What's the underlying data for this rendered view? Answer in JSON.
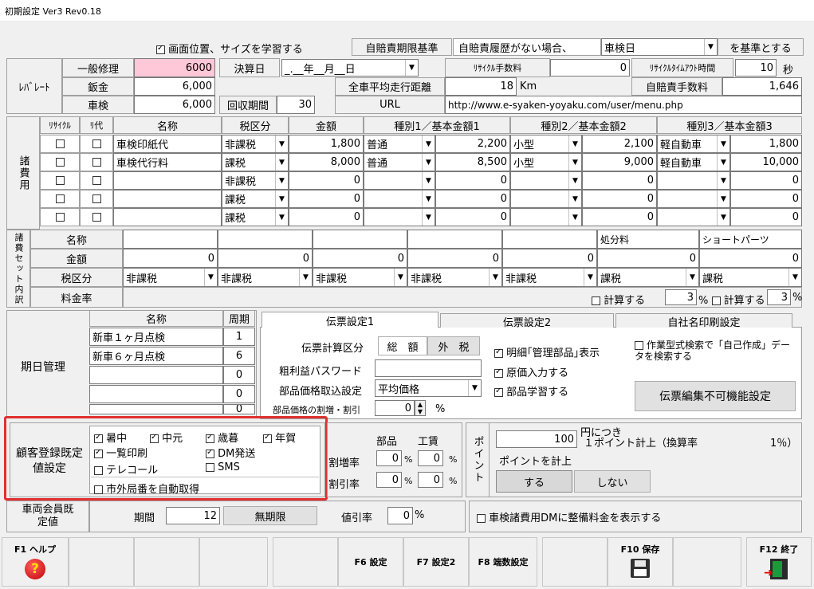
{
  "window": {
    "title": "初期設定 Ver3 Rev0.18"
  },
  "top": {
    "learn_label": "画面位置、サイズを学習する",
    "jibai_basis_label": "自賠責期限基準",
    "no_history_label": "自賠責履歴がない場合、",
    "basis_value": "車検日",
    "basis_suffix": "を基準とする"
  },
  "labor": {
    "section_label": "ﾚﾊﾞﾚｰﾄ",
    "rows": [
      {
        "label": "一般修理",
        "value": "6000"
      },
      {
        "label": "鈑金",
        "value": "6,000"
      },
      {
        "label": "車検",
        "value": "6,000"
      }
    ],
    "settle_label": "決算日",
    "settle_value": "_.__年__月__日",
    "collect_label": "回収期間",
    "collect_value": "30",
    "recycle_fee_label": "ﾘｻｲｸﾙ手数料",
    "recycle_fee_value": "0",
    "recycle_timeout_label": "ﾘｻｲｸﾙﾀｲﾑｱｳﾄ時間",
    "recycle_timeout_value": "10",
    "recycle_timeout_unit": "秒",
    "avg_distance_label": "全車平均走行距離",
    "avg_distance_value": "18",
    "avg_distance_unit": "Km",
    "jibai_fee_label": "自賠責手数料",
    "jibai_fee_value": "1,646",
    "url_label": "URL",
    "url_value": "http://www.e-syaken-yoyaku.com/user/menu.php"
  },
  "fees": {
    "section_label": "諸費用",
    "headers": [
      "ﾘｻｲｸﾙ",
      "ﾘ代",
      "名称",
      "税区分",
      "金額",
      "種別1／基本金額1",
      "種別2／基本金額2",
      "種別3／基本金額3"
    ],
    "rows": [
      {
        "name": "車検印紙代",
        "tax": "非課税",
        "amount": "1,800",
        "t1": "普通",
        "a1": "2,200",
        "t2": "小型",
        "a2": "2,100",
        "t3": "軽自動車",
        "a3": "1,800"
      },
      {
        "name": "車検代行料",
        "tax": "課税",
        "amount": "8,000",
        "t1": "普通",
        "a1": "8,500",
        "t2": "小型",
        "a2": "9,000",
        "t3": "軽自動車",
        "a3": "10,000"
      },
      {
        "name": "",
        "tax": "非課税",
        "amount": "0",
        "t1": "",
        "a1": "0",
        "t2": "",
        "a2": "0",
        "t3": "",
        "a3": "0"
      },
      {
        "name": "",
        "tax": "課税",
        "amount": "0",
        "t1": "",
        "a1": "0",
        "t2": "",
        "a2": "0",
        "t3": "",
        "a3": "0"
      },
      {
        "name": "",
        "tax": "課税",
        "amount": "0",
        "t1": "",
        "a1": "0",
        "t2": "",
        "a2": "0",
        "t3": "",
        "a3": "0"
      }
    ]
  },
  "set": {
    "section_label": "諸費セット内訳",
    "name_label": "名称",
    "amount_label": "金額",
    "tax_label": "税区分",
    "rate_label": "料金率",
    "names": [
      "",
      "",
      "",
      "",
      "",
      "処分料",
      "ショートパーツ"
    ],
    "amounts": [
      "0",
      "0",
      "0",
      "0",
      "0",
      "0",
      "0"
    ],
    "taxes": [
      "非課税",
      "非課税",
      "非課税",
      "非課税",
      "非課税",
      "課税",
      "課税"
    ],
    "calc_label": "計算する",
    "calc1_value": "3",
    "calc2_value": "3",
    "pct": "%"
  },
  "period": {
    "section_label": "期日管理",
    "name_header": "名称",
    "cycle_header": "周期",
    "rows": [
      {
        "name": "新車１ヶ月点検",
        "cycle": "1"
      },
      {
        "name": "新車６ヶ月点検",
        "cycle": "6"
      },
      {
        "name": "",
        "cycle": "0"
      },
      {
        "name": "",
        "cycle": "0"
      },
      {
        "name": "",
        "cycle": "0"
      }
    ]
  },
  "tabs": {
    "items": [
      "伝票設定1",
      "伝票設定2",
      "自社名印刷設定"
    ]
  },
  "slip": {
    "calc_label": "伝票計算区分",
    "total_label": "総　額",
    "outside_label": "外　税",
    "password_label": "粗利益パスワード",
    "parts_price_label": "部品価格取込設定",
    "parts_price_value": "平均価格",
    "discount_label": "部品価格の割増・割引",
    "discount_value": "0",
    "discount_unit": "%",
    "detail_label": "明細｢管理部品｣表示",
    "cost_label": "原価入力する",
    "learn_parts_label": "部品学習する",
    "work_search_label": "作業型式検索で「自己作成」データを検索する",
    "uneditable_label": "伝票編集不可機能設定"
  },
  "customer": {
    "section_label": "顧客登録既定値設定",
    "summer": "暑中",
    "midyear": "中元",
    "yearend": "歳暮",
    "newyear": "年賀",
    "list_print": "一覧印刷",
    "dm_send": "DM発送",
    "telecall": "テレコール",
    "sms": "SMS",
    "area_code": "市外局番を自動取得"
  },
  "rates": {
    "parts_label": "部品",
    "labor_label": "工賃",
    "markup_label": "割増率",
    "discount_label": "割引率",
    "parts_markup": "0",
    "labor_markup": "0",
    "parts_discount": "0",
    "labor_discount": "0",
    "pct": "%"
  },
  "points": {
    "section_label": "ポイント",
    "yen_value": "100",
    "per_label": "円につき",
    "per_point": "１ポイント計上（換算率",
    "rate_value": "1％）",
    "count_label": "ポイントを計上",
    "do_label": "する",
    "dont_label": "しない"
  },
  "member": {
    "section_label": "車両会員既定値",
    "period_label": "期間",
    "period_value": "12",
    "unlimited_label": "無期限",
    "discount_label": "値引率",
    "discount_value": "0",
    "pct": "%"
  },
  "dm": {
    "label": "車検諸費用DMに整備料金を表示する"
  },
  "fkeys": {
    "f1": "F1 ヘルプ",
    "f6": "F6 設定",
    "f7": "F7 設定2",
    "f8": "F8 端数設定",
    "f10": "F10 保存",
    "f12": "F12 終了"
  },
  "colors": {
    "highlight": "#e03030",
    "input_pink": "#ffc8d8"
  }
}
